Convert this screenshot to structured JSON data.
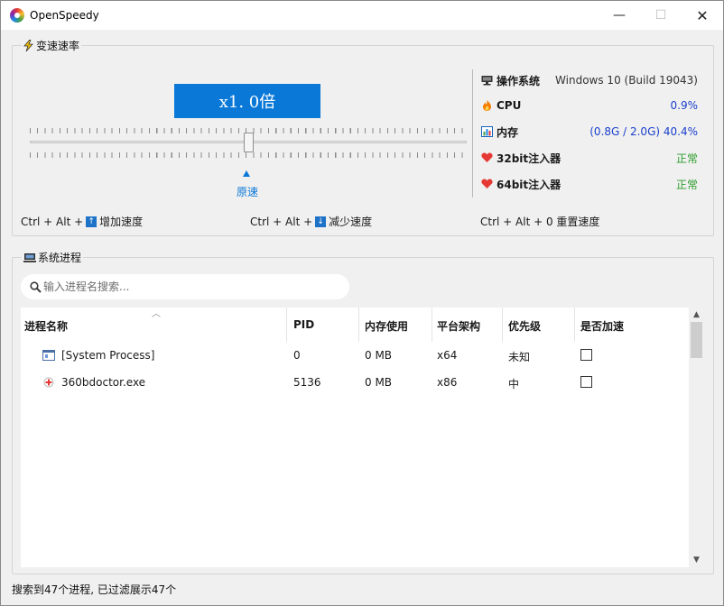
{
  "window": {
    "title": "OpenSpeedy",
    "minimize": "—",
    "maximize": "☐",
    "close": "✕"
  },
  "speed": {
    "group_title": "变速速率",
    "display": "x1. 0倍",
    "origin_label": "原速",
    "shortcut_increase": "Ctrl + Alt + ↑ 增加速度",
    "shortcut_increase_prefix": "Ctrl + Alt +",
    "shortcut_increase_key": "↑",
    "shortcut_increase_label": "增加速度",
    "shortcut_decrease_prefix": "Ctrl + Alt +",
    "shortcut_decrease_key": "↓",
    "shortcut_decrease_label": "减少速度",
    "shortcut_reset": "Ctrl + Alt + 0 重置速度"
  },
  "system_info": {
    "os_label": "操作系统",
    "os_value": "Windows 10 (Build 19043)",
    "cpu_label": "CPU",
    "cpu_value": "0.9%",
    "mem_label": "内存",
    "mem_value": "(0.8G / 2.0G) 40.4%",
    "inj32_label": "32bit注入器",
    "inj32_value": "正常",
    "inj64_label": "64bit注入器",
    "inj64_value": "正常",
    "accent_color": "#1a3fcc",
    "ok_color": "#2e9d2e"
  },
  "process": {
    "group_title": "系统进程",
    "search_placeholder": "输入进程名搜索...",
    "columns": [
      "进程名称",
      "PID",
      "内存使用",
      "平台架构",
      "优先级",
      "是否加速"
    ],
    "rows": [
      {
        "name": "[System Process]",
        "pid": "0",
        "mem": "0 MB",
        "arch": "x64",
        "priority": "未知",
        "accelerated": false,
        "icon": "system-process-icon"
      },
      {
        "name": "360bdoctor.exe",
        "pid": "5136",
        "mem": "0 MB",
        "arch": "x86",
        "priority": "中",
        "accelerated": false,
        "icon": "360-doctor-icon"
      }
    ]
  },
  "status_bar": {
    "text": "搜索到47个进程, 已过滤展示47个"
  }
}
